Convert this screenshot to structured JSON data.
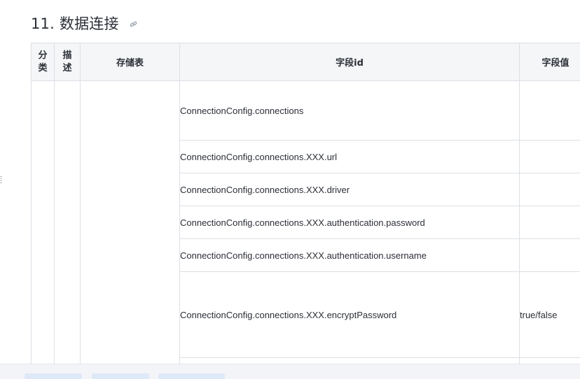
{
  "section": {
    "number": "11.",
    "title": "数据连接",
    "anchor_icon": "link-icon"
  },
  "table": {
    "headers": {
      "category": "分类",
      "category_lines": [
        "分",
        "类"
      ],
      "description": "描述",
      "description_lines": [
        "描",
        "述"
      ],
      "storage": "存储表",
      "field_id": "字段id",
      "field_value": "字段值"
    },
    "rows": [
      {
        "field_id": "ConnectionConfig.connections",
        "field_value": ""
      },
      {
        "field_id": "ConnectionConfig.connections.XXX.url",
        "field_value": ""
      },
      {
        "field_id": "ConnectionConfig.connections.XXX.driver",
        "field_value": ""
      },
      {
        "field_id": "ConnectionConfig.connections.XXX.authentication.password",
        "field_value": ""
      },
      {
        "field_id": "ConnectionConfig.connections.XXX.authentication.username",
        "field_value": ""
      },
      {
        "field_id": "ConnectionConfig.connections.XXX.encryptPassword",
        "field_value": "true/false"
      },
      {
        "field_id": "",
        "field_value": ""
      }
    ]
  },
  "colors": {
    "border": "#dcdfe5",
    "header_bg": "#f5f6f8",
    "text": "#2b2f36",
    "bottom_bar": "#f2f4f8",
    "pill": "#dfe8f6"
  }
}
